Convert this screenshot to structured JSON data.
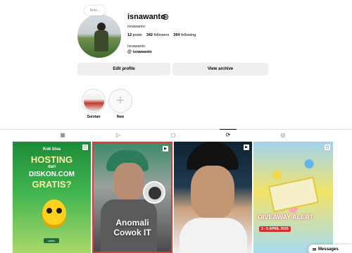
{
  "profile": {
    "note": "Note...",
    "username": "isnawanto",
    "display_name": "isnawanto",
    "stats": {
      "posts_count": "12",
      "posts_label": "posts",
      "followers_count": "342",
      "followers_label": "followers",
      "following_count": "394",
      "following_label": "following"
    },
    "bio_name": "Isnawanto",
    "threads_handle": "isnawanto",
    "threads_icon": "@"
  },
  "actions": {
    "edit_profile": "Edit profile",
    "view_archive": "View archive"
  },
  "highlights": [
    {
      "label": "Sorotan"
    },
    {
      "label": "New",
      "icon": "+"
    }
  ],
  "tabs": [
    {
      "name": "posts",
      "icon": "▦"
    },
    {
      "name": "reels",
      "icon": "▷"
    },
    {
      "name": "saved",
      "icon": "◻"
    },
    {
      "name": "reposts",
      "icon": "⟳",
      "active": true
    },
    {
      "name": "tagged",
      "icon": "◎"
    }
  ],
  "posts": {
    "post1": {
      "line1": "Kok bisa",
      "line2": "HOSTING",
      "line3": "dari",
      "line4": "DISKON.COM",
      "line5": "GRATIS?",
      "brand": "cabtik"
    },
    "post2": {
      "title_line1": "Anomali",
      "title_line2": "Cowok IT"
    },
    "post4": {
      "alert": "GIVEAWAY ALERT",
      "date": "3 - 5 APRIL 2025"
    }
  },
  "messages": {
    "label": "Messages",
    "icon": "✉"
  }
}
